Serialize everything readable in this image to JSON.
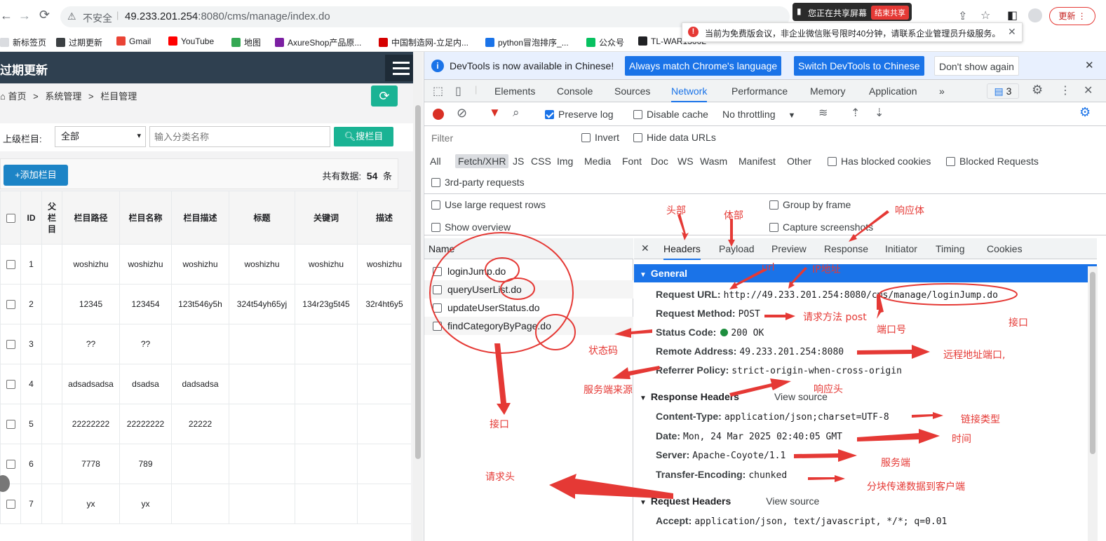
{
  "browser": {
    "insecure_label": "不安全",
    "url_host": "49.233.201.254",
    "url_rest": ":8080/cms/manage/index.do",
    "update_button": "更新",
    "share_status": "您正在共享屏幕",
    "end_share": "结束共享",
    "notice": "当前为免费版会议，非企业微信账号限时40分钟，请联系企业管理员升级服务。",
    "bookmarks": [
      "新标签页",
      "过期更新",
      "Gmail",
      "YouTube",
      "地图",
      "AxureShop产品原...",
      "中国制造网-立足内...",
      "python冒泡排序_...",
      "公众号",
      "TL-WAR1300L"
    ]
  },
  "app": {
    "title": "过期更新",
    "breadcrumb": {
      "home": "首页",
      "sep": ">",
      "level1": "系统管理",
      "level2": "栏目管理"
    },
    "filter": {
      "label": "上级栏目:",
      "selected": "全部",
      "placeholder": "输入分类名称",
      "search_button": "搜栏目"
    },
    "add_button": "+添加栏目",
    "total_label": "共有数据:",
    "total_count": "54",
    "total_unit": "条",
    "table": {
      "headers": [
        "",
        "ID",
        "父栏目",
        "栏目路径",
        "栏目名称",
        "栏目描述",
        "标题",
        "关键词",
        "描述"
      ],
      "rows": [
        [
          "1",
          "",
          "woshizhu",
          "woshizhu",
          "woshizhu",
          "woshizhu",
          "woshizhu",
          "woshizhu"
        ],
        [
          "2",
          "",
          "12345",
          "123454",
          "123t546y5h",
          "324t54yh65yj",
          "134r23g5t45",
          "32r4ht6y5"
        ],
        [
          "3",
          "",
          "??",
          "??",
          "",
          "",
          "",
          ""
        ],
        [
          "4",
          "",
          "adsadsadsa",
          "dsadsa",
          "dadsadsa",
          "",
          "",
          ""
        ],
        [
          "5",
          "",
          "22222222",
          "22222222",
          "22222",
          "",
          "",
          ""
        ],
        [
          "6",
          "",
          "7778",
          "789",
          "",
          "",
          "",
          ""
        ],
        [
          "7",
          "",
          "yx",
          "yx",
          "",
          "",
          "",
          ""
        ]
      ]
    }
  },
  "devtools": {
    "infobar": {
      "message": "DevTools is now available in Chinese!",
      "btn1": "Always match Chrome's language",
      "btn2": "Switch DevTools to Chinese",
      "btn3": "Don't show again"
    },
    "tabs": [
      "Elements",
      "Console",
      "Sources",
      "Network",
      "Performance",
      "Memory",
      "Application"
    ],
    "active_tab": "Network",
    "issues_count": "3",
    "network": {
      "preserve_log": "Preserve log",
      "disable_cache": "Disable cache",
      "throttling": "No throttling",
      "filter_placeholder": "Filter",
      "invert": "Invert",
      "hide_data_urls": "Hide data URLs",
      "types": [
        "All",
        "Fetch/XHR",
        "JS",
        "CSS",
        "Img",
        "Media",
        "Font",
        "Doc",
        "WS",
        "Wasm",
        "Manifest",
        "Other"
      ],
      "has_blocked_cookies": "Has blocked cookies",
      "blocked_requests": "Blocked Requests",
      "third_party": "3rd-party requests",
      "large_rows": "Use large request rows",
      "group_by_frame": "Group by frame",
      "show_overview": "Show overview",
      "capture_screenshots": "Capture screenshots",
      "name_header": "Name",
      "requests": [
        "loginJump.do",
        "queryUserList.do",
        "updateUserStatus.do",
        "findCategoryByPage.do"
      ]
    },
    "detail": {
      "tabs": [
        "Headers",
        "Payload",
        "Preview",
        "Response",
        "Initiator",
        "Timing",
        "Cookies"
      ],
      "general_title": "General",
      "general": [
        {
          "k": "Request URL:",
          "v": "http://49.233.201.254:8080/cms/manage/loginJump.do"
        },
        {
          "k": "Request Method:",
          "v": "POST"
        },
        {
          "k": "Status Code:",
          "v": "200 OK"
        },
        {
          "k": "Remote Address:",
          "v": "49.233.201.254:8080"
        },
        {
          "k": "Referrer Policy:",
          "v": "strict-origin-when-cross-origin"
        }
      ],
      "response_headers_title": "Response Headers",
      "view_source": "View source",
      "response_headers": [
        {
          "k": "Content-Type:",
          "v": "application/json;charset=UTF-8"
        },
        {
          "k": "Date:",
          "v": "Mon, 24 Mar 2025 02:40:05 GMT"
        },
        {
          "k": "Server:",
          "v": "Apache-Coyote/1.1"
        },
        {
          "k": "Transfer-Encoding:",
          "v": "chunked"
        }
      ],
      "request_headers_title": "Request Headers",
      "request_headers": [
        {
          "k": "Accept:",
          "v": "application/json, text/javascript, */*; q=0.01"
        }
      ]
    }
  },
  "annotations": {
    "header": "头部",
    "payload": "体部",
    "response_body": "响应体",
    "url": "url",
    "ip": "IP地址",
    "method": "请求方法 post",
    "port": "端口号",
    "interface_right": "接口",
    "status": "状态码",
    "remote": "远程地址端口,",
    "referrer": "服务端来源",
    "resp_head": "响应头",
    "content_type": "链接类型",
    "time": "时间",
    "server": "服务端",
    "chunked": "分块传递数据到客户端",
    "request_head": "请求头",
    "interface_left": "接口"
  },
  "colors": {
    "annotation": "#e53935",
    "accent": "#1a73e8",
    "app_header": "#2f4050",
    "green_btn": "#1ab394",
    "blue_btn": "#1c84c6"
  }
}
